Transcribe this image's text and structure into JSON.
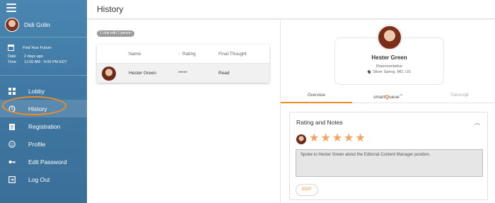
{
  "app": {
    "user_name": "Didi Golin"
  },
  "event": {
    "title": "Find Your Future",
    "date_label": "Date",
    "date_value": "2 days ago",
    "time_label": "Time",
    "time_value": "11:00 AM - 5:00 PM EDT"
  },
  "nav": {
    "items": [
      {
        "label": "Lobby",
        "icon": "lobby-icon"
      },
      {
        "label": "History",
        "icon": "history-icon",
        "active": true
      },
      {
        "label": "Registration",
        "icon": "clipboard-icon"
      },
      {
        "label": "Profile",
        "icon": "profile-icon"
      },
      {
        "label": "Edit Password",
        "icon": "key-icon"
      },
      {
        "label": "Log Out",
        "icon": "logout-icon"
      }
    ]
  },
  "header": {
    "title": "History"
  },
  "history": {
    "badge": "1 chat with 1 person",
    "columns": {
      "name": "Name",
      "rating": "Rating",
      "final": "Final Thought"
    },
    "rows": [
      {
        "name": "Hester Green",
        "rating": "*****",
        "final": "Read"
      }
    ]
  },
  "profile": {
    "name": "Hester Green",
    "role": "Representative",
    "location": "Silver Spring, MD, US"
  },
  "tabs": {
    "overview": "Overview",
    "smartqueue_prefix": "smart",
    "smartqueue_q": "Q",
    "smartqueue_suffix": "ueue",
    "smartqueue_tm": "™",
    "transcript": "Transcript"
  },
  "notes": {
    "title": "Rating and Notes",
    "stars": 5,
    "text": "Spoke to Hester Green about the Editorial Content Manager position.",
    "edit_label": "EDIT"
  },
  "colors": {
    "accent": "#f08a24",
    "sidebar": "#4682ad",
    "star": "#f6a25c"
  }
}
